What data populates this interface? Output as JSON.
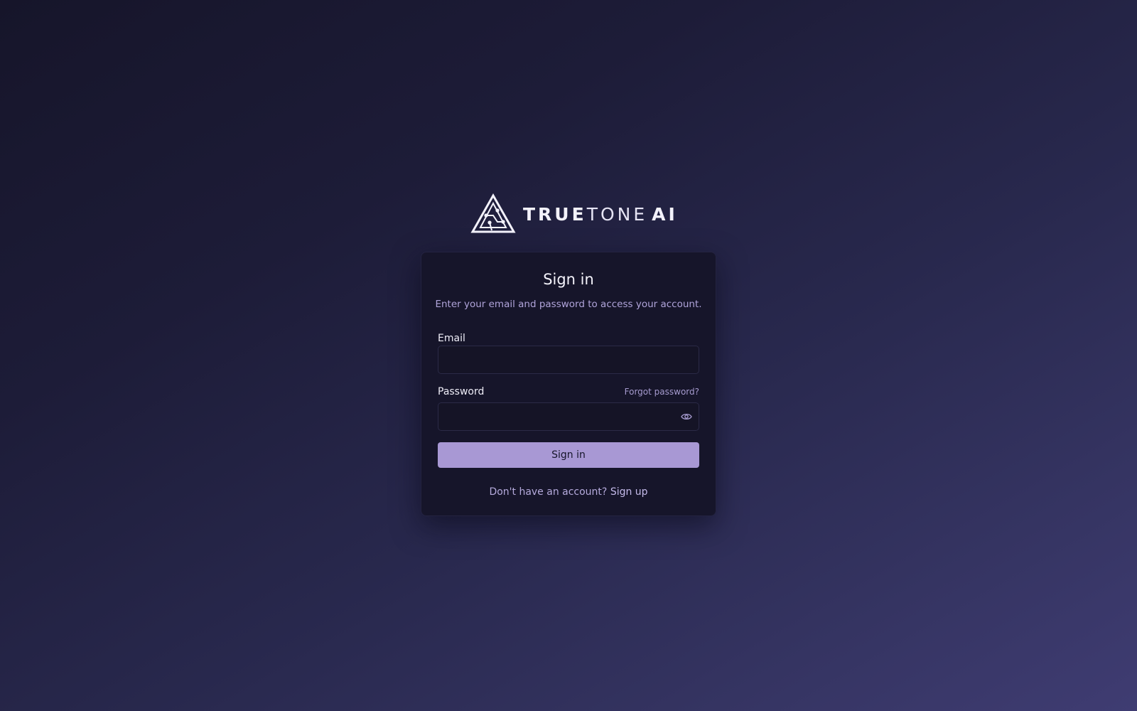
{
  "brand": {
    "name_part1": "TRUE",
    "name_part2": "TONE",
    "name_part3": "AI",
    "logo_icon": "circuit-triangle-logo"
  },
  "card": {
    "title": "Sign in",
    "subtitle": "Enter your email and password to access your account."
  },
  "form": {
    "email_label": "Email",
    "email_value": "",
    "password_label": "Password",
    "password_value": "",
    "forgot_password": "Forgot password?",
    "toggle_icon": "eye-icon",
    "submit_label": "Sign in"
  },
  "footer": {
    "prompt": "Don't have an account?",
    "signup_link": "Sign up"
  },
  "colors": {
    "background_start": "#16152a",
    "background_end": "#3f3c72",
    "card_background": "#16152a",
    "accent": "#a898d4",
    "muted_text": "#b0a4da"
  }
}
